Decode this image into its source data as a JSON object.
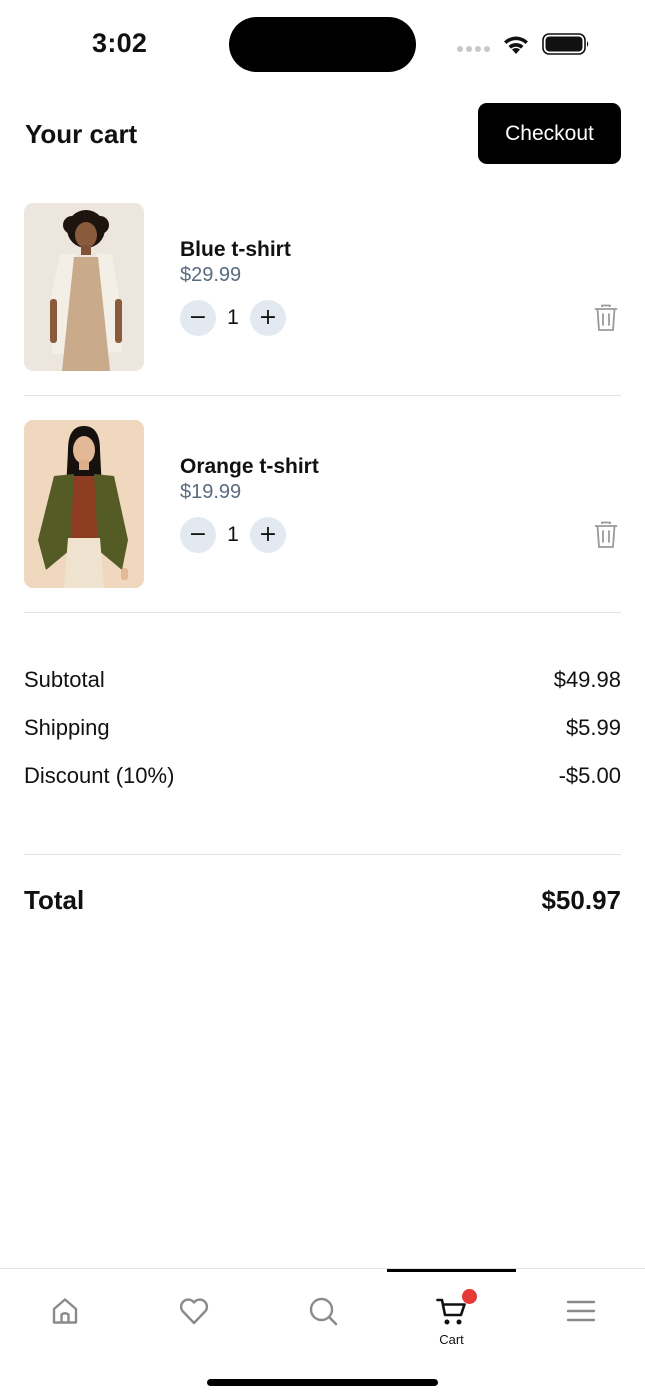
{
  "status_bar": {
    "time": "3:02",
    "icons": [
      "signal-dots-icon",
      "wifi-icon",
      "battery-icon"
    ]
  },
  "header": {
    "title": "Your cart",
    "checkout_label": "Checkout"
  },
  "cart": {
    "items": [
      {
        "name": "Blue t-shirt",
        "price": "$29.99",
        "quantity": "1",
        "image": "woman-in-beige-dress-and-cream-blazer"
      },
      {
        "name": "Orange t-shirt",
        "price": "$19.99",
        "quantity": "1",
        "image": "woman-in-rust-top-and-olive-blazer"
      }
    ],
    "qty_minus_symbol": "−",
    "qty_plus_symbol": "+"
  },
  "summary": {
    "subtotal_label": "Subtotal",
    "subtotal_value": "$49.98",
    "shipping_label": "Shipping",
    "shipping_value": "$5.99",
    "discount_label": "Discount (10%)",
    "discount_value": "-$5.00",
    "total_label": "Total",
    "total_value": "$50.97"
  },
  "bottom_nav": {
    "items": [
      {
        "icon": "home-icon"
      },
      {
        "icon": "heart-icon"
      },
      {
        "icon": "search-icon"
      },
      {
        "icon": "cart-icon",
        "label": "Cart",
        "active": true,
        "badge": true
      },
      {
        "icon": "menu-icon"
      }
    ]
  },
  "colors": {
    "accent": "#000000",
    "price": "#5b6b80",
    "qty_button_bg": "#e3e9f1",
    "badge": "#e53935",
    "divider": "#e2e2e2"
  }
}
